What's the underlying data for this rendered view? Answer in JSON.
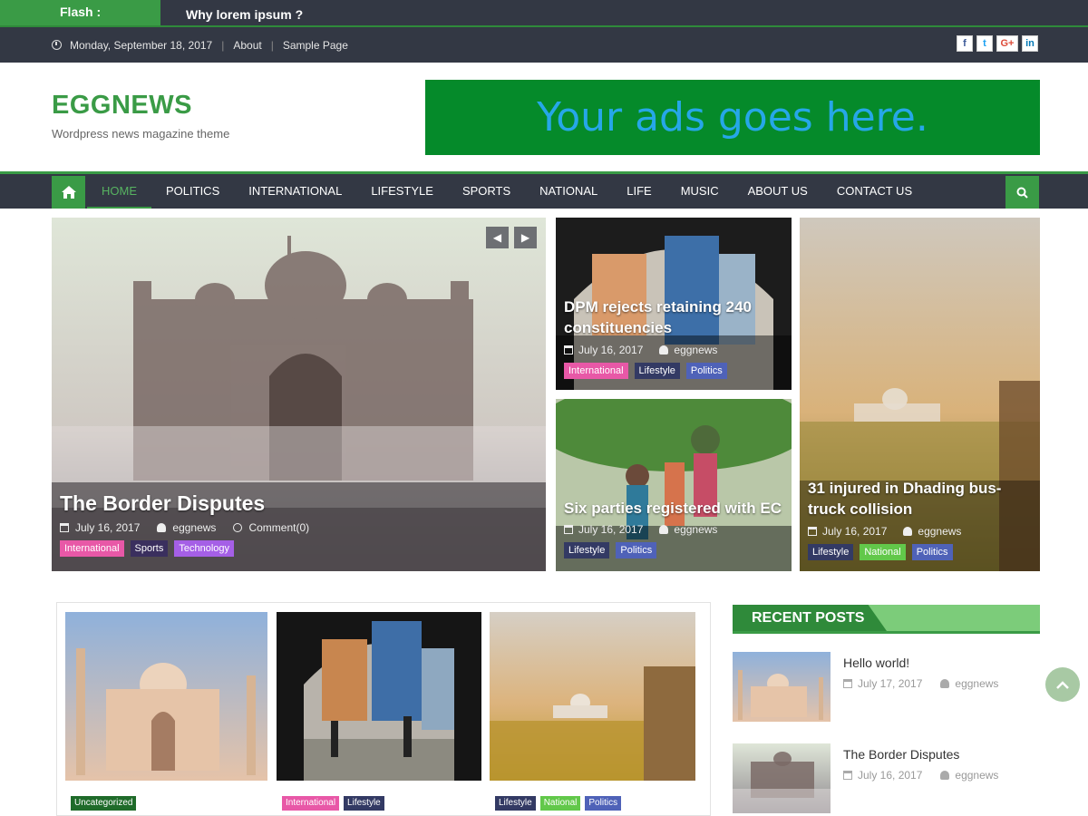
{
  "flash": {
    "label": "Flash :",
    "text": "Why lorem ipsum ?"
  },
  "topbar": {
    "date": "Monday, September 18, 2017",
    "links": [
      "About",
      "Sample Page"
    ],
    "social": [
      "f",
      "t",
      "G+",
      "in"
    ]
  },
  "header": {
    "logo": "EGGNEWS",
    "tagline": "Wordpress news magazine theme",
    "ad_text": "Your ads goes here."
  },
  "nav": {
    "items": [
      "HOME",
      "POLITICS",
      "INTERNATIONAL",
      "LIFESTYLE",
      "SPORTS",
      "NATIONAL",
      "LIFE",
      "MUSIC",
      "ABOUT US",
      "CONTACT US"
    ]
  },
  "featured": {
    "main": {
      "title": "The Border Disputes",
      "date": "July 16, 2017",
      "author": "eggnews",
      "comments": "Comment(0)",
      "tags": [
        "International",
        "Sports",
        "Technology"
      ]
    },
    "top": {
      "title": "DPM rejects retaining 240 constituencies",
      "date": "July 16, 2017",
      "author": "eggnews",
      "tags": [
        "International",
        "Lifestyle",
        "Politics"
      ]
    },
    "bottom": {
      "title": "Six parties registered with EC",
      "date": "July 16, 2017",
      "author": "eggnews",
      "tags": [
        "Lifestyle",
        "Politics"
      ]
    },
    "right": {
      "title": "31 injured in Dhading bus-truck collision",
      "date": "July 16, 2017",
      "author": "eggnews",
      "tags": [
        "Lifestyle",
        "National",
        "Politics"
      ]
    }
  },
  "grid": [
    {
      "tags": [
        "Uncategorized"
      ]
    },
    {
      "tags": [
        "International",
        "Lifestyle"
      ]
    },
    {
      "tags": [
        "Lifestyle",
        "National",
        "Politics"
      ]
    }
  ],
  "recent": {
    "title": "RECENT POSTS",
    "items": [
      {
        "name": "Hello world!",
        "date": "July 17, 2017",
        "author": "eggnews"
      },
      {
        "name": "The Border Disputes",
        "date": "July 16, 2017",
        "author": "eggnews"
      }
    ]
  },
  "colors": {
    "accent": "#3a9b46",
    "dark": "#333844",
    "ad_bg": "#058a2a",
    "ad_text": "#26a7e8"
  }
}
